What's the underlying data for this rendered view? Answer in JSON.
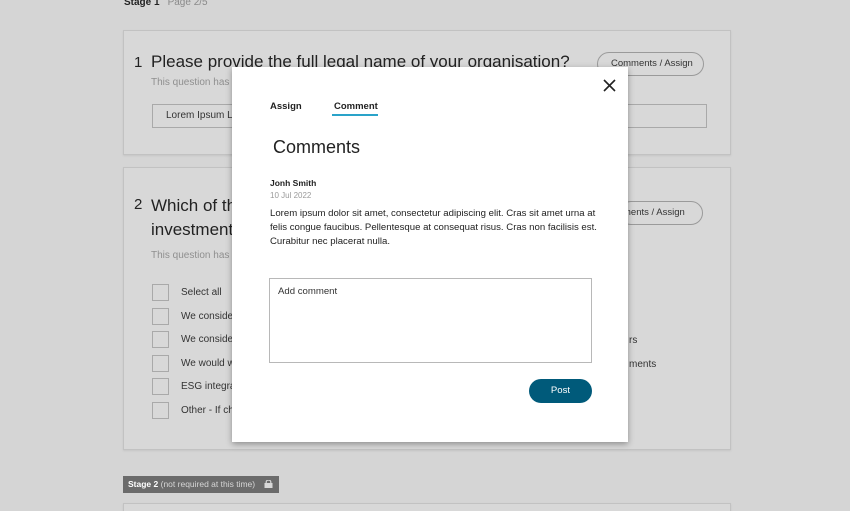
{
  "header": {
    "stage": "Stage 1",
    "page": "Page 2/5"
  },
  "q1": {
    "num": "1",
    "title": "Please provide the full legal name of your organisation?",
    "subtitle": "This question has b",
    "comments_btn": "Comments / Assign",
    "input_value": "Lorem Ipsum Lt"
  },
  "q2": {
    "num": "2",
    "title_line1": "Which of th",
    "title_line2": "investment",
    "subtitle": "This question has b",
    "comments_btn": "ments / Assign",
    "options": [
      "Select all",
      "We consider",
      "We consider",
      "We would wi",
      "ESG integrat",
      "Other - If cho"
    ],
    "option_tails": [
      "rs",
      "ments"
    ]
  },
  "stage2": {
    "label": "Stage 2",
    "note": "(not required at this time)"
  },
  "modal": {
    "tab_assign": "Assign",
    "tab_comment": "Comment",
    "title": "Comments",
    "author": "Jonh Smith",
    "date": "10 Jul 2022",
    "body": "Lorem ipsum dolor sit amet, consectetur adipiscing elit. Cras sit amet urna at felis congue faucibus. Pellentesque at consequat risus. Cras non facilisis est. Curabitur nec placerat nulla.",
    "comment_placeholder": "Add comment",
    "post_label": "Post"
  },
  "colors": {
    "accent_underline": "#2aa3c9",
    "post_button": "#005a7a"
  },
  "icons": {
    "close": "close-icon",
    "lock": "lock-icon"
  }
}
